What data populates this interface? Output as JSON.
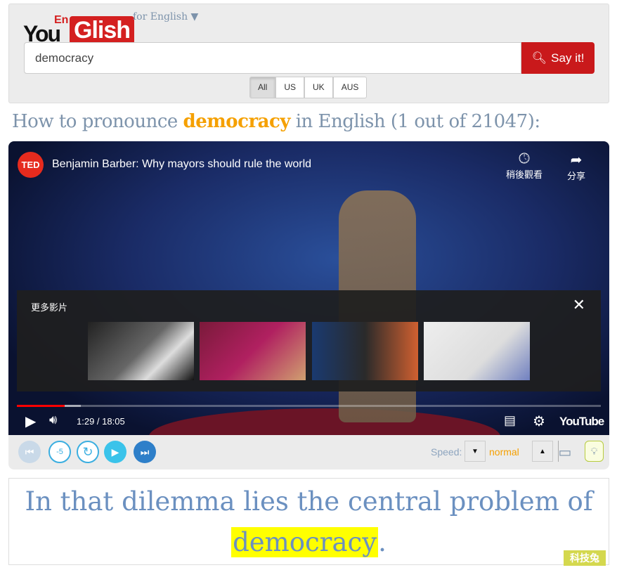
{
  "header": {
    "logo_you": "You",
    "logo_en": "En",
    "logo_glish": "Glish",
    "language_selector": "for English ▼",
    "search_value": "democracy",
    "say_it_label": "Say it!",
    "accents": [
      "All",
      "US",
      "UK",
      "AUS"
    ],
    "active_accent": "All"
  },
  "result_title": {
    "prefix": "How to pronounce ",
    "word": "democracy",
    "suffix": " in English (1 out of 21047):"
  },
  "player": {
    "channel_logo": "TED",
    "video_title": "Benjamin Barber: Why mayors should rule the world",
    "watch_later": "稍後觀看",
    "share": "分享",
    "more_videos": "更多影片",
    "time": "1:29 / 18:05",
    "brand": "YouTube",
    "progress_percent": 8.2
  },
  "controls": {
    "speed_label": "Speed:",
    "speed_value": "normal"
  },
  "caption": {
    "before": "In that dilemma lies the central problem of ",
    "word": "democracy",
    "after": "."
  },
  "watermark": "科技兔",
  "colors": {
    "accent": "#c9191b",
    "highlight": "#ffff00",
    "word": "#f5a000",
    "caption": "#6b90c0"
  }
}
